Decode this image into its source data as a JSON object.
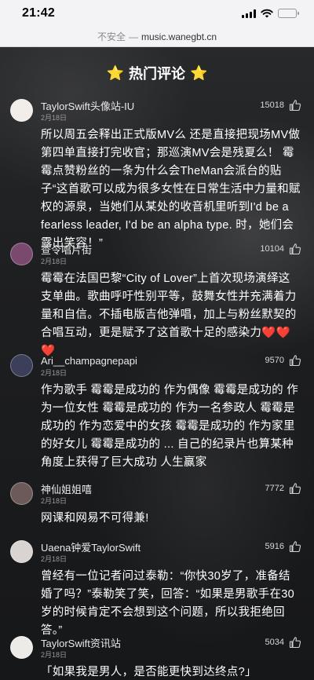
{
  "status_bar": {
    "time": "21:42"
  },
  "url_bar": {
    "security": "不安全",
    "separator": "—",
    "host": "music.wanegbt.cn"
  },
  "header": {
    "title": "热门评论",
    "left_icon": "star-emoji",
    "right_icon": "star-emoji"
  },
  "comments": [
    {
      "username": "TaylorSwift头像站-IU",
      "date": "2月18日",
      "likes": "15018",
      "text": "所以周五会释出正式版MV么 还是直接把现场MV做第四单直接打完收官；那巡演MV会是残夏么！ 霉霉点赞粉丝的一条为什么会TheMan会派台的贴子“这首歌可以成为很多女性在日常生活中力量和赋权的源泉，当她们从某处的收音机里听到I'd be a fearless leader, I'd be an alpha type. 时，她们会露出笑容！”",
      "avatar_color": "#f1ede8"
    },
    {
      "username": "查令唱片街",
      "date": "2月18日",
      "likes": "10104",
      "text": "霉霉在法国巴黎“City of Lover”上首次现场演绎这支单曲。歌曲呼吁性别平等，鼓舞女性并充满着力量和自信。不插电版吉他弹唱，加上与粉丝默契的合唱互动，更是赋予了这首歌十足的感染力",
      "hearts": "❤️❤️❤️",
      "avatar_color": "#7a4a6e"
    },
    {
      "username": "Ari__champagnepapi",
      "date": "2月18日",
      "likes": "9570",
      "text": "作为歌手 霉霉是成功的 作为偶像 霉霉是成功的 作为一位女性 霉霉是成功的 作为一名参政人 霉霉是成功的 作为恋爱中的女孩 霉霉是成功的 作为家里的好女儿 霉霉是成功的 ... 自己的纪录片也算某种角度上获得了巨大成功 人生赢家",
      "avatar_color": "#3c3f5a"
    },
    {
      "username": "神仙姐姐嘻",
      "date": "2月18日",
      "likes": "7772",
      "text": "网课和网易不可得兼!",
      "avatar_color": "#6b5a58"
    },
    {
      "username": "Uaena钟爱TaylorSwift",
      "date": "2月18日",
      "likes": "5916",
      "text": "曾经有一位记者问过泰勒：“你快30岁了，准备结婚了吗？”泰勒笑了笑，回答：“如果是男歌手在30岁的时候肯定不会想到这个问题，所以我拒绝回答。”",
      "avatar_color": "#d9d4d2"
    },
    {
      "username": "TaylorSwift资讯站",
      "date": "2月18日",
      "likes": "5034",
      "text": "「如果我是男人，是否能更快到达终点?」",
      "avatar_color": "#ecebe8"
    }
  ]
}
